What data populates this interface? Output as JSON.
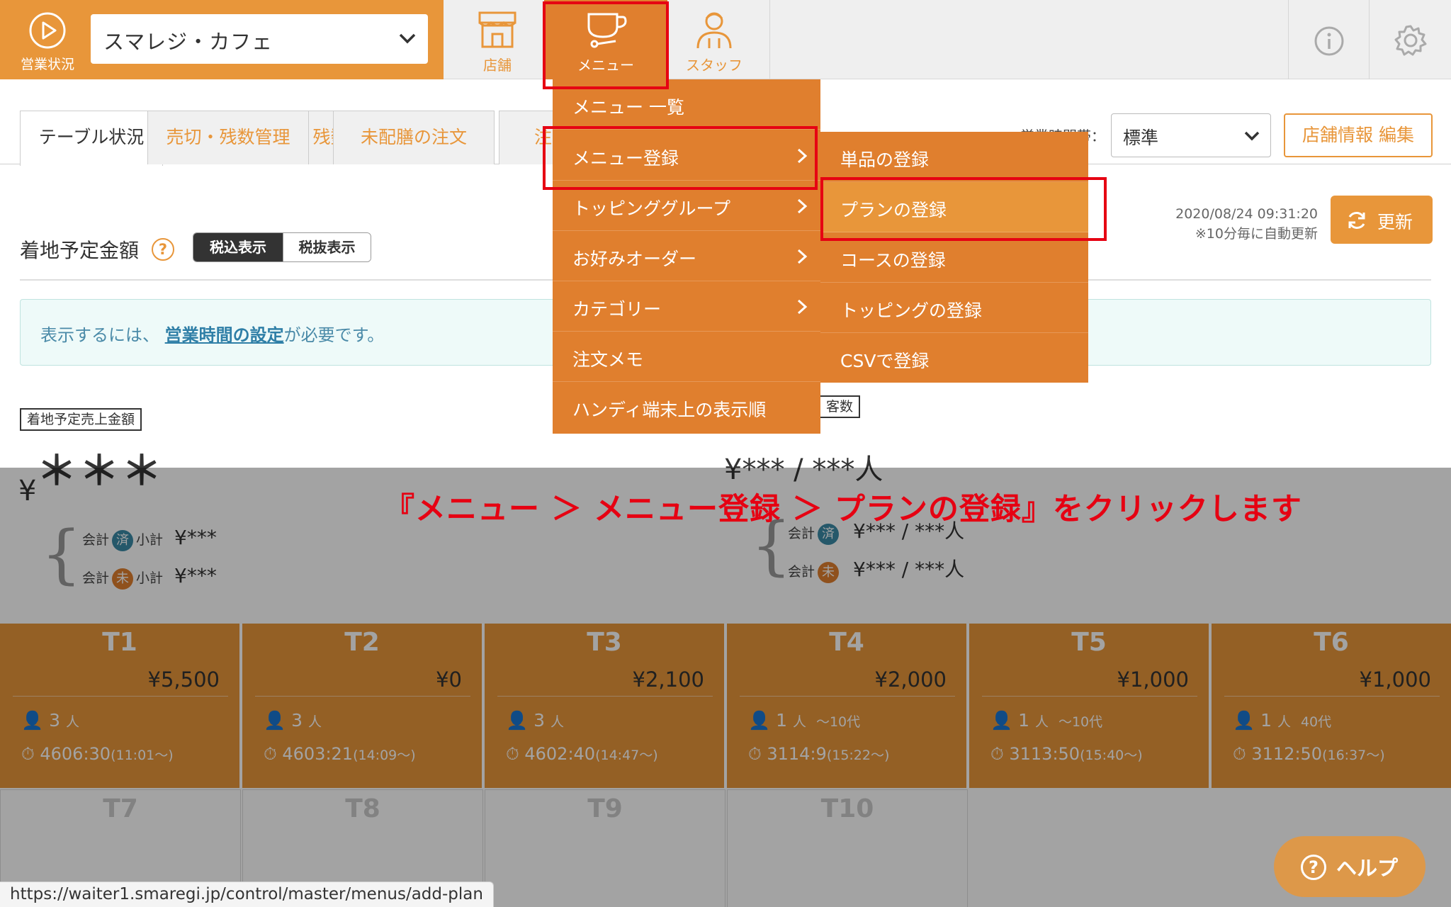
{
  "header": {
    "status_label": "営業状況",
    "store_name": "スマレジ・カフェ",
    "nav": [
      {
        "label": "店舗",
        "icon": "storefront-icon"
      },
      {
        "label": "メニュー",
        "icon": "coffee-cup-icon"
      },
      {
        "label": "スタッフ",
        "icon": "staff-icon"
      }
    ]
  },
  "tabs": [
    "テーブル状況",
    "売切・残数管理",
    "未配膳の注文",
    "注文履歴"
  ],
  "business_hours": {
    "label": "営業時間帯：",
    "selected": "標準"
  },
  "store_edit_label": "店舗情報 編集",
  "summary": {
    "title": "着地予定金額",
    "tax_in": "税込表示",
    "tax_out": "税抜表示",
    "timestamp": "2020/08/24 09:31:20",
    "auto_update": "※10分毎に自動更新",
    "refresh_label": "更新"
  },
  "notice": {
    "prefix": "表示するには、",
    "link": "営業時間の設定",
    "suffix": "が必要です。"
  },
  "sales": {
    "label": "着地予定売上金額",
    "stars": "＊＊＊",
    "yen": "¥",
    "paid_row": "会計",
    "paid_badge": "済",
    "unpaid_badge": "未",
    "subtotal": "小計",
    "masked_value": "¥***"
  },
  "guests": {
    "label": "客数",
    "masked_value": "¥*** / ***人",
    "masked_small": "¥*** / ***人"
  },
  "menu_dropdown": {
    "items": [
      {
        "label": "メニュー 一覧",
        "has_sub": false
      },
      {
        "label": "メニュー登録",
        "has_sub": true
      },
      {
        "label": "トッピンググループ",
        "has_sub": true
      },
      {
        "label": "お好みオーダー",
        "has_sub": true
      },
      {
        "label": "カテゴリー",
        "has_sub": true
      },
      {
        "label": "注文メモ",
        "has_sub": false
      },
      {
        "label": "ハンディ端末上の表示順",
        "has_sub": false
      }
    ]
  },
  "submenu": {
    "items": [
      "単品の登録",
      "プランの登録",
      "コースの登録",
      "トッピングの登録",
      "CSVで登録"
    ]
  },
  "instruction": "『メニュー ＞ メニュー登録 ＞ プランの登録』をクリックします",
  "tables": [
    {
      "name": "T1",
      "amount": "¥5,500",
      "guests": "3",
      "unit": "人",
      "age": "",
      "timer": "4606:30",
      "since": "(11:01〜)"
    },
    {
      "name": "T2",
      "amount": "¥0",
      "guests": "3",
      "unit": "人",
      "age": "",
      "timer": "4603:21",
      "since": "(14:09〜)"
    },
    {
      "name": "T3",
      "amount": "¥2,100",
      "guests": "3",
      "unit": "人",
      "age": "",
      "timer": "4602:40",
      "since": "(14:47〜)"
    },
    {
      "name": "T4",
      "amount": "¥2,000",
      "guests": "1",
      "unit": "人",
      "age": "〜10代",
      "timer": "3114:9",
      "since": "(15:22〜)"
    },
    {
      "name": "T5",
      "amount": "¥1,000",
      "guests": "1",
      "unit": "人",
      "age": "〜10代",
      "timer": "3113:50",
      "since": "(15:40〜)"
    },
    {
      "name": "T6",
      "amount": "¥1,000",
      "guests": "1",
      "unit": "人",
      "age": "40代",
      "timer": "3112:50",
      "since": "(16:37〜)"
    }
  ],
  "empty_tables": [
    "T7",
    "T8",
    "T9",
    "T10"
  ],
  "help_label": "ヘルプ",
  "status_url": "https://waiter1.smaregi.jp/control/master/menus/add-plan",
  "colors": {
    "accent": "#e8963a",
    "menu_bg": "#e07f2e",
    "highlight_red": "#e60012"
  }
}
